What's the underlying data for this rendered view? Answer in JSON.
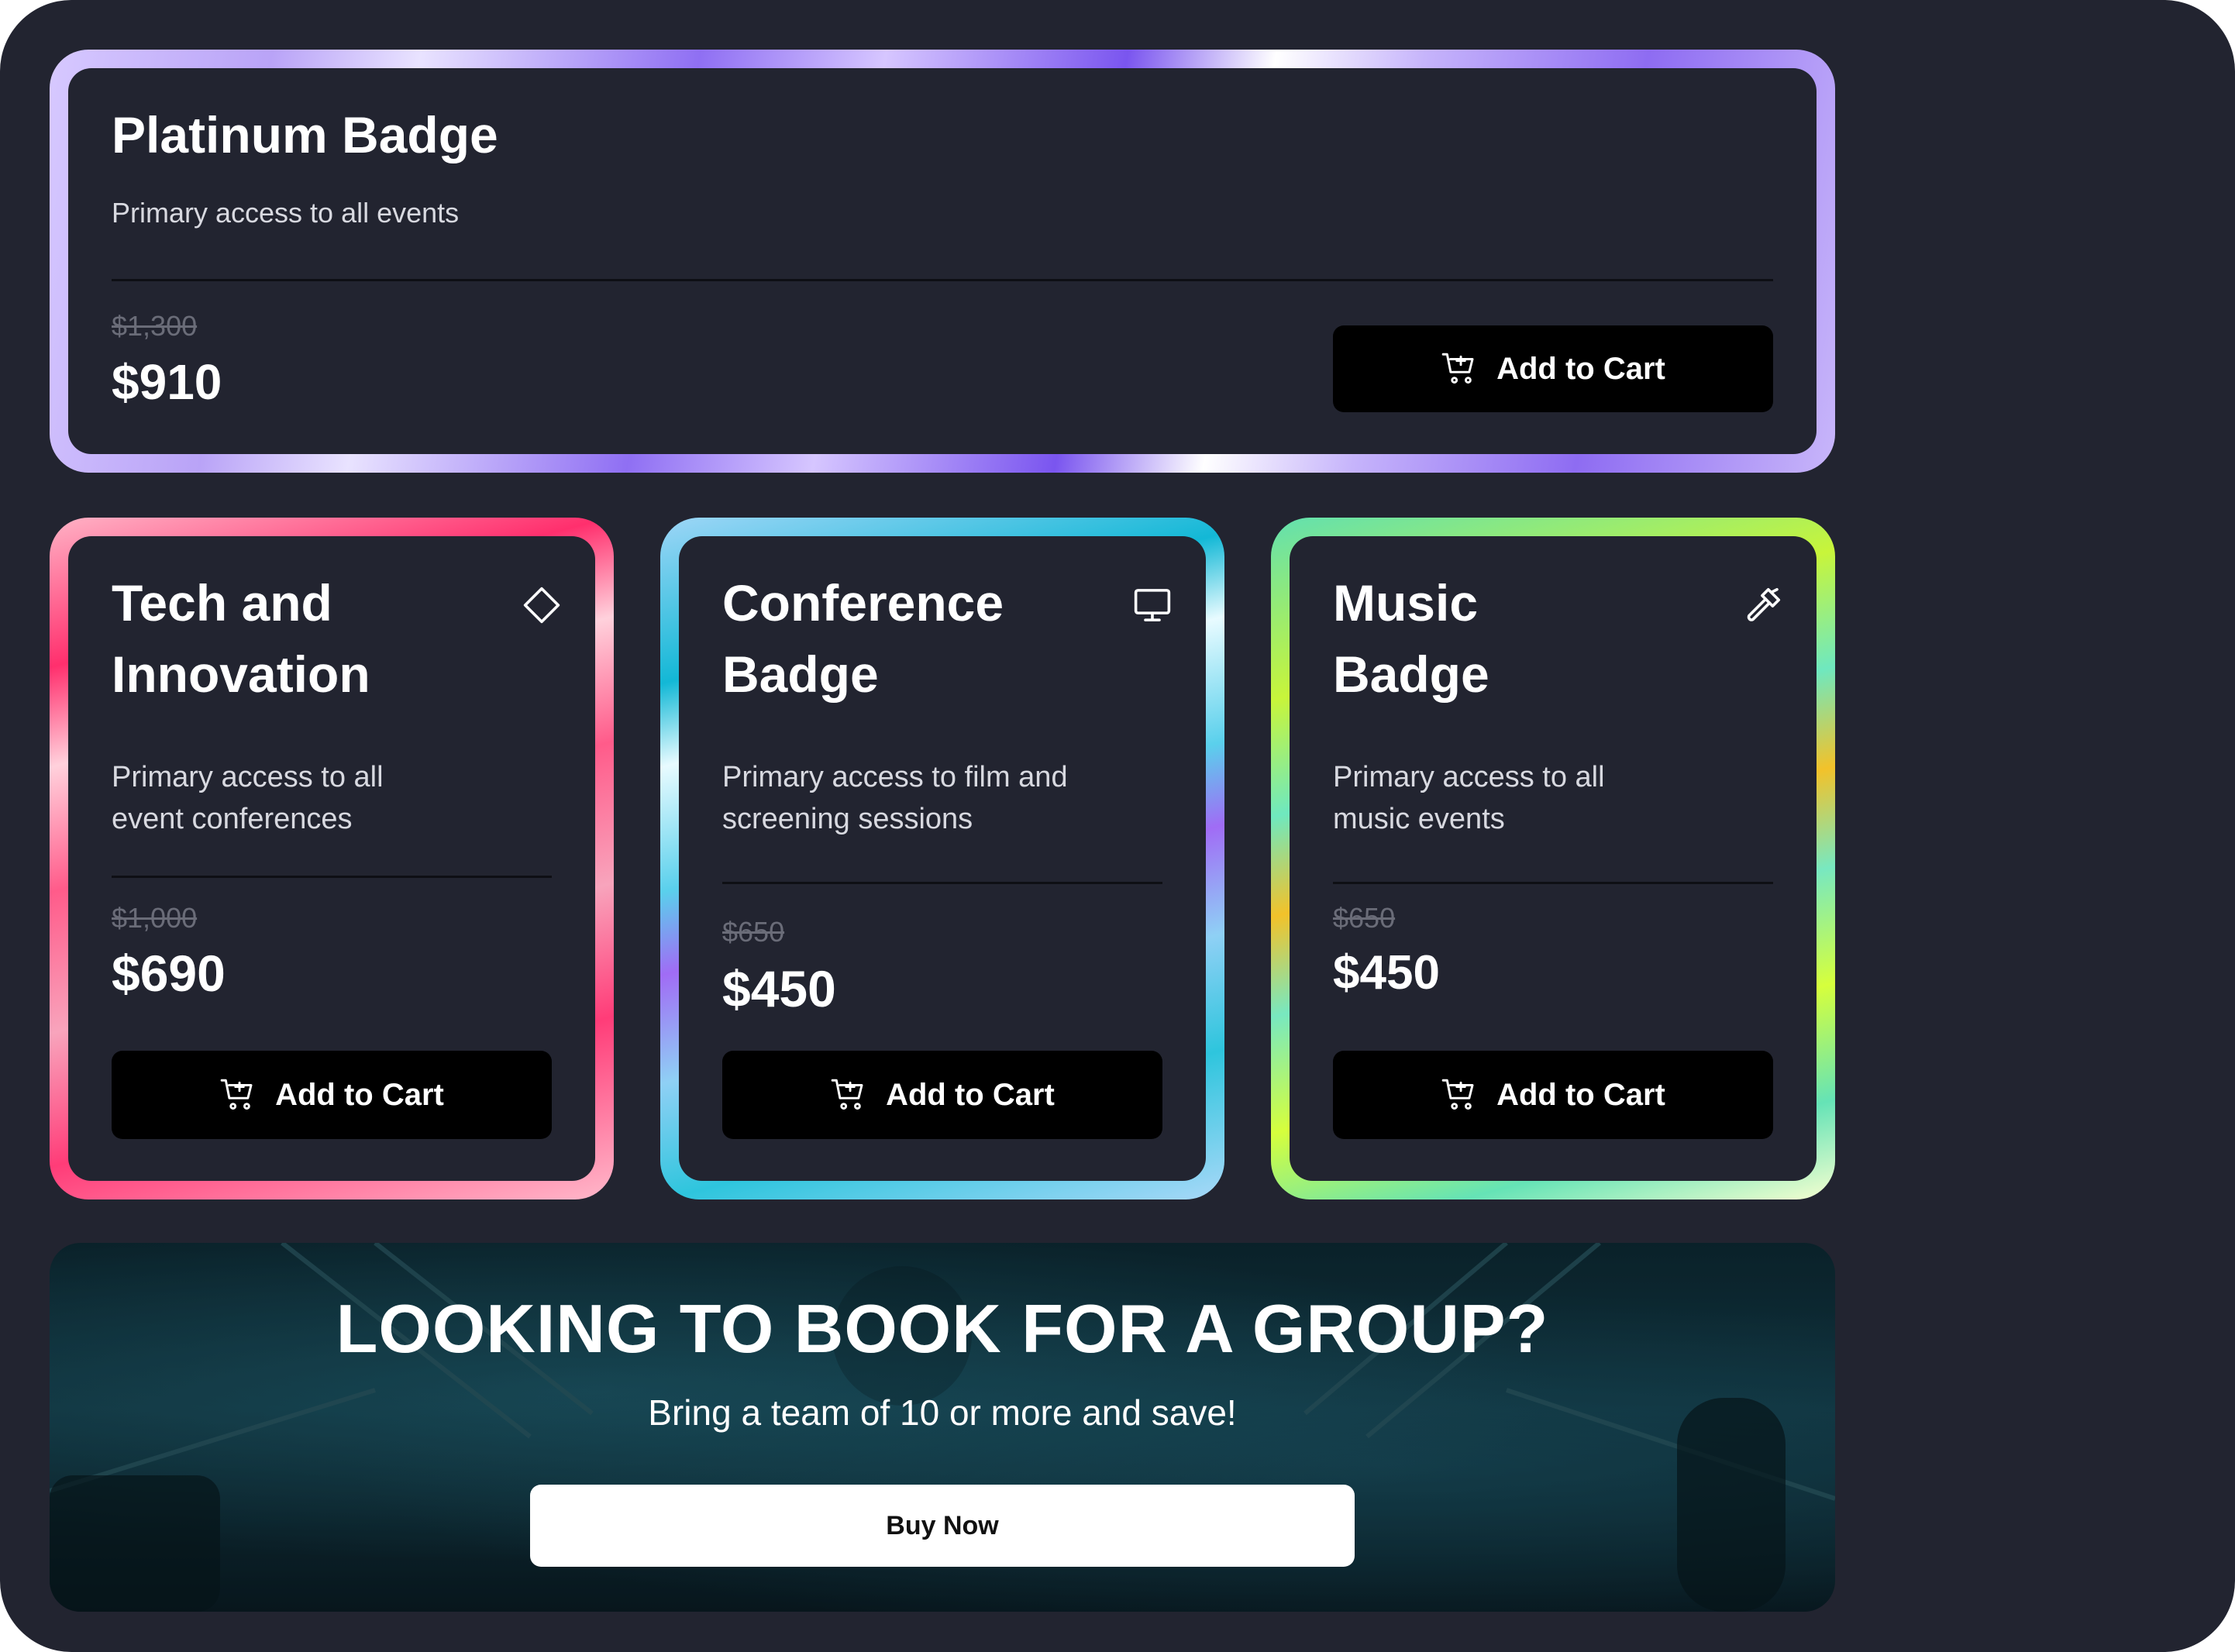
{
  "platinum": {
    "title": "Platinum Badge",
    "description": "Primary access to all events",
    "old_price": "$1,300",
    "price": "$910",
    "cart_label": "Add to Cart"
  },
  "cards": [
    {
      "title_line1": "Tech and",
      "title_line2": "Innovation",
      "desc_line1": "Primary access to all",
      "desc_line2": "event conferences",
      "icon": "diamond-icon",
      "old_price": "$1,000",
      "price": "$690",
      "cart_label": "Add to Cart"
    },
    {
      "title_line1": "Conference",
      "title_line2": "Badge",
      "desc_line1": "Primary access to film and",
      "desc_line2": "screening sessions",
      "icon": "monitor-icon",
      "old_price": "$650",
      "price": "$450",
      "cart_label": "Add to Cart"
    },
    {
      "title_line1": "Music",
      "title_line2": "Badge",
      "desc_line1": "Primary access to all",
      "desc_line2": "music events",
      "icon": "hammer-icon",
      "old_price": "$650",
      "price": "$450",
      "cart_label": "Add to Cart"
    }
  ],
  "group": {
    "title": "LOOKING TO BOOK FOR A GROUP?",
    "subtitle": "Bring a team of 10 or more and save!",
    "button_label": "Buy Now"
  },
  "colors": {
    "background": "#222430",
    "button": "#000000",
    "platinum_accent": "#8f6ff3",
    "tech_accent": "#ff3c78",
    "conference_accent": "#2ec5dd",
    "music_accent": "#65e3b6"
  }
}
